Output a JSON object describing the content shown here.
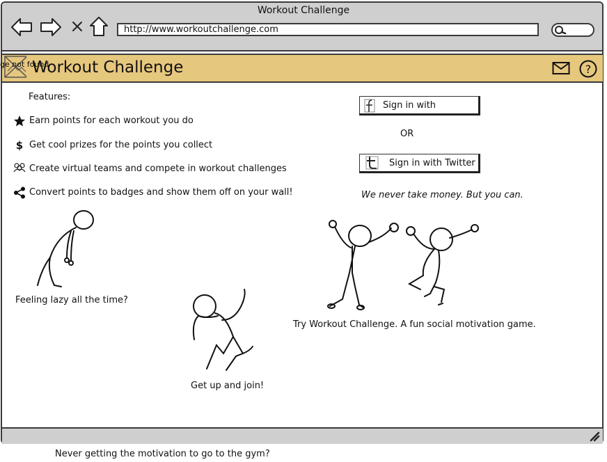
{
  "window": {
    "title": "Workout Challenge",
    "url": "http://www.workoutchallenge.com"
  },
  "header": {
    "logo_alt": "ge not found",
    "title": "Workout Challenge"
  },
  "features": {
    "heading": "Features:",
    "items": [
      {
        "icon": "star-icon",
        "label": "Earn points for each workout you do"
      },
      {
        "icon": "dollar-icon",
        "label": "Get cool prizes for the points you collect"
      },
      {
        "icon": "group-icon",
        "label": "Create virtual teams and compete in workout challenges"
      },
      {
        "icon": "share-icon",
        "label": "Convert points to badges and show them off on your wall!"
      }
    ]
  },
  "signin": {
    "facebook_label": "Sign in with",
    "or_text": "OR",
    "twitter_label": "Sign in with Twitter",
    "tagline": "We never take money. But you can."
  },
  "captions": {
    "lazy": "Feeling lazy all the time?",
    "join": "Get up and join!",
    "try": "Try Workout Challenge. A fun social motivation game.",
    "gym": "Never getting the motivation to go to the gym?"
  },
  "colors": {
    "header_bg": "#e6c77e",
    "chrome_bg": "#cfcfcf",
    "border": "#3a3a3a"
  }
}
